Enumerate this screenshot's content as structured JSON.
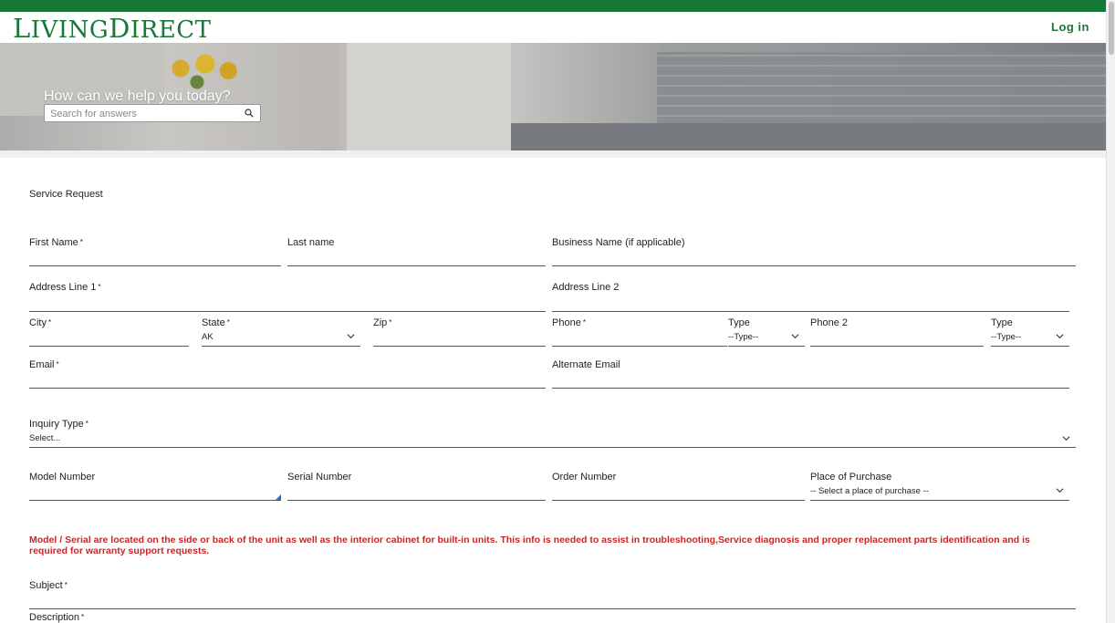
{
  "header": {
    "logo_l": "L",
    "logo_iving": "IVING",
    "logo_d": "D",
    "logo_irect": "IRECT",
    "login": "Log in"
  },
  "hero": {
    "title": "How can we help you today?",
    "search_placeholder": "Search for answers"
  },
  "form": {
    "title": "Service Request",
    "first_name": "First Name",
    "last_name": "Last name",
    "business_name": "Business Name (if applicable)",
    "address1": "Address Line 1",
    "address2": "Address Line 2",
    "city": "City",
    "state": "State",
    "state_value": "AK",
    "zip": "Zip",
    "phone": "Phone",
    "type1": "Type",
    "type1_value": "--Type--",
    "phone2": "Phone 2",
    "type2": "Type",
    "type2_value": "--Type--",
    "email": "Email",
    "alt_email": "Alternate Email",
    "inquiry_type": "Inquiry Type",
    "inquiry_value": "Select...",
    "model_number": "Model Number",
    "serial_number": "Serial Number",
    "order_number": "Order Number",
    "place_of_purchase": "Place of Purchase",
    "place_value": "-- Select a place of purchase --",
    "note": "Model / Serial are located on the side or back of the unit as well as the interior cabinet for built-in units. This info is needed to assist in troubleshooting,Service diagnosis and proper replacement parts identification and is required for warranty support requests.",
    "subject": "Subject",
    "description": "Description",
    "required_mark": "*"
  },
  "colors": {
    "brand_green": "#167a36",
    "warning_red": "#c62828"
  },
  "icons": {
    "search": "search-icon",
    "dropdown": "chevron-down-icon"
  }
}
